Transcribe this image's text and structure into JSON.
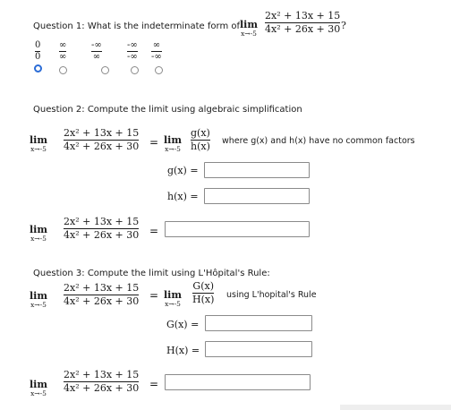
{
  "q1": {
    "prompt": "Question 1: What is the indeterminate form of",
    "lim_word": "lim",
    "lim_sub": "x→-5",
    "numerator": "2x² + 13x + 15",
    "denominator": "4x² + 26x + 30",
    "qmark": "?",
    "options": [
      {
        "num": "0",
        "den": "0",
        "selected": true
      },
      {
        "num": "∞",
        "den": "∞",
        "selected": false
      },
      {
        "num": "-∞",
        "den": "∞",
        "selected": false
      },
      {
        "num": "-∞",
        "den": "-∞",
        "selected": false
      },
      {
        "num": "∞",
        "den": "-∞",
        "selected": false
      }
    ]
  },
  "q2": {
    "prompt": "Question 2: Compute the limit using algebraic simplification",
    "lim_word": "lim",
    "lim_sub": "x→-5",
    "numerator": "2x² + 13x + 15",
    "denominator": "4x² + 26x + 30",
    "eq": "=",
    "gnum": "g(x)",
    "hden": "h(x)",
    "note": "where g(x) and h(x) have no common factors",
    "g_label": "g(x) =",
    "h_label": "h(x) =",
    "g_value": "",
    "h_value": "",
    "answer_value": ""
  },
  "q3": {
    "prompt": "Question 3: Compute the limit using L'Hôpital's Rule:",
    "lim_word": "lim",
    "lim_sub": "x→-5",
    "numerator": "2x² + 13x + 15",
    "denominator": "4x² + 26x + 30",
    "eq": "=",
    "Gnum": "G(x)",
    "Hden": "H(x)",
    "note": "using L'hopital's Rule",
    "G_label": "G(x) =",
    "H_label": "H(x) =",
    "G_value": "",
    "H_value": "",
    "answer_value": ""
  }
}
